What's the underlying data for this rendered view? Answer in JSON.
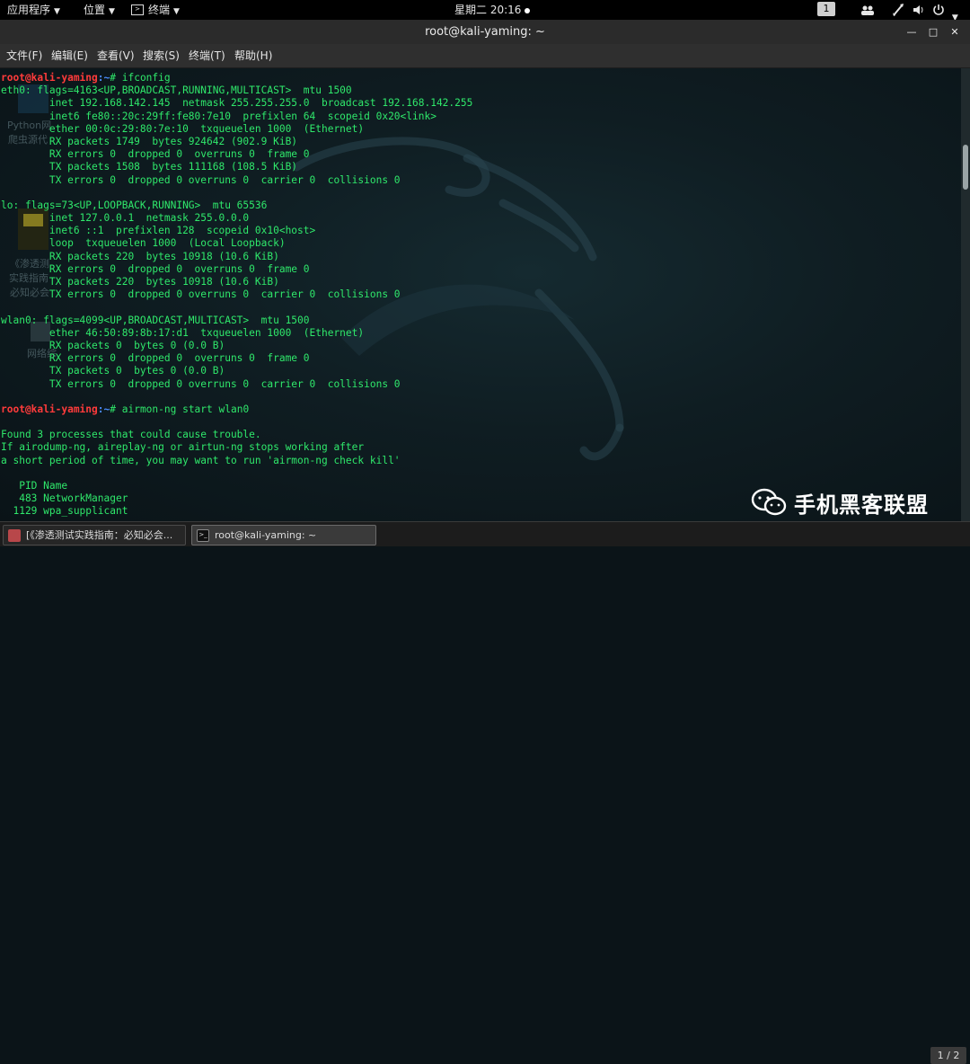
{
  "topbar": {
    "applications": "应用程序",
    "places": "位置",
    "terminal_menu": "终端",
    "clock": "星期二 20:16",
    "workspace": "1"
  },
  "window": {
    "title": "root@kali-yaming: ~"
  },
  "menubar": {
    "items": [
      "文件(F)",
      "编辑(E)",
      "查看(V)",
      "搜索(S)",
      "终端(T)",
      "帮助(H)"
    ]
  },
  "desktop_labels": [
    "Python网",
    "爬虫源代",
    "《渗透测",
    "实践指南",
    "必知必会",
    "网络综"
  ],
  "terminal": {
    "lines": [
      {
        "kind": "prompt",
        "user": "root@kali-yaming",
        "path": ":~",
        "cmd": "# ifconfig"
      },
      {
        "kind": "text",
        "text": "eth0: flags=4163<UP,BROADCAST,RUNNING,MULTICAST>  mtu 1500"
      },
      {
        "kind": "text",
        "text": "        inet 192.168.142.145  netmask 255.255.255.0  broadcast 192.168.142.255"
      },
      {
        "kind": "text",
        "text": "        inet6 fe80::20c:29ff:fe80:7e10  prefixlen 64  scopeid 0x20<link>"
      },
      {
        "kind": "text",
        "text": "        ether 00:0c:29:80:7e:10  txqueuelen 1000  (Ethernet)"
      },
      {
        "kind": "text",
        "text": "        RX packets 1749  bytes 924642 (902.9 KiB)"
      },
      {
        "kind": "text",
        "text": "        RX errors 0  dropped 0  overruns 0  frame 0"
      },
      {
        "kind": "text",
        "text": "        TX packets 1508  bytes 111168 (108.5 KiB)"
      },
      {
        "kind": "text",
        "text": "        TX errors 0  dropped 0 overruns 0  carrier 0  collisions 0"
      },
      {
        "kind": "text",
        "text": ""
      },
      {
        "kind": "text",
        "text": "lo: flags=73<UP,LOOPBACK,RUNNING>  mtu 65536"
      },
      {
        "kind": "text",
        "text": "        inet 127.0.0.1  netmask 255.0.0.0"
      },
      {
        "kind": "text",
        "text": "        inet6 ::1  prefixlen 128  scopeid 0x10<host>"
      },
      {
        "kind": "text",
        "text": "        loop  txqueuelen 1000  (Local Loopback)"
      },
      {
        "kind": "text",
        "text": "        RX packets 220  bytes 10918 (10.6 KiB)"
      },
      {
        "kind": "text",
        "text": "        RX errors 0  dropped 0  overruns 0  frame 0"
      },
      {
        "kind": "text",
        "text": "        TX packets 220  bytes 10918 (10.6 KiB)"
      },
      {
        "kind": "text",
        "text": "        TX errors 0  dropped 0 overruns 0  carrier 0  collisions 0"
      },
      {
        "kind": "text",
        "text": ""
      },
      {
        "kind": "text",
        "text": "wlan0: flags=4099<UP,BROADCAST,MULTICAST>  mtu 1500"
      },
      {
        "kind": "text",
        "text": "        ether 46:50:89:8b:17:d1  txqueuelen 1000  (Ethernet)"
      },
      {
        "kind": "text",
        "text": "        RX packets 0  bytes 0 (0.0 B)"
      },
      {
        "kind": "text",
        "text": "        RX errors 0  dropped 0  overruns 0  frame 0"
      },
      {
        "kind": "text",
        "text": "        TX packets 0  bytes 0 (0.0 B)"
      },
      {
        "kind": "text",
        "text": "        TX errors 0  dropped 0 overruns 0  carrier 0  collisions 0"
      },
      {
        "kind": "text",
        "text": ""
      },
      {
        "kind": "prompt",
        "user": "root@kali-yaming",
        "path": ":~",
        "cmd": "# airmon-ng start wlan0"
      },
      {
        "kind": "text",
        "text": ""
      },
      {
        "kind": "plain",
        "text": "Found 3 processes that could cause trouble."
      },
      {
        "kind": "plain",
        "text": "If airodump-ng, aireplay-ng or airtun-ng stops working after"
      },
      {
        "kind": "plain",
        "text": "a short period of time, you may want to run 'airmon-ng check kill'"
      },
      {
        "kind": "text",
        "text": ""
      },
      {
        "kind": "plain",
        "text": "   PID Name"
      },
      {
        "kind": "plain",
        "text": "   483 NetworkManager"
      },
      {
        "kind": "plain",
        "text": "  1129 wpa_supplicant"
      }
    ]
  },
  "watermark": {
    "text": "手机黑客联盟"
  },
  "taskbar": {
    "tasks": [
      {
        "label": "[《渗透测试实践指南：必知必会...",
        "icon": "document-icon"
      },
      {
        "label": "root@kali-yaming: ~",
        "icon": "terminal-icon"
      }
    ],
    "pager": "1 / 2"
  },
  "colors": {
    "terminal_text": "#2fe86b",
    "prompt_user": "#ff3b3b",
    "prompt_path": "#4a8cff",
    "topbar_bg": "#000000",
    "titlebar_bg": "#2b2b2b"
  }
}
